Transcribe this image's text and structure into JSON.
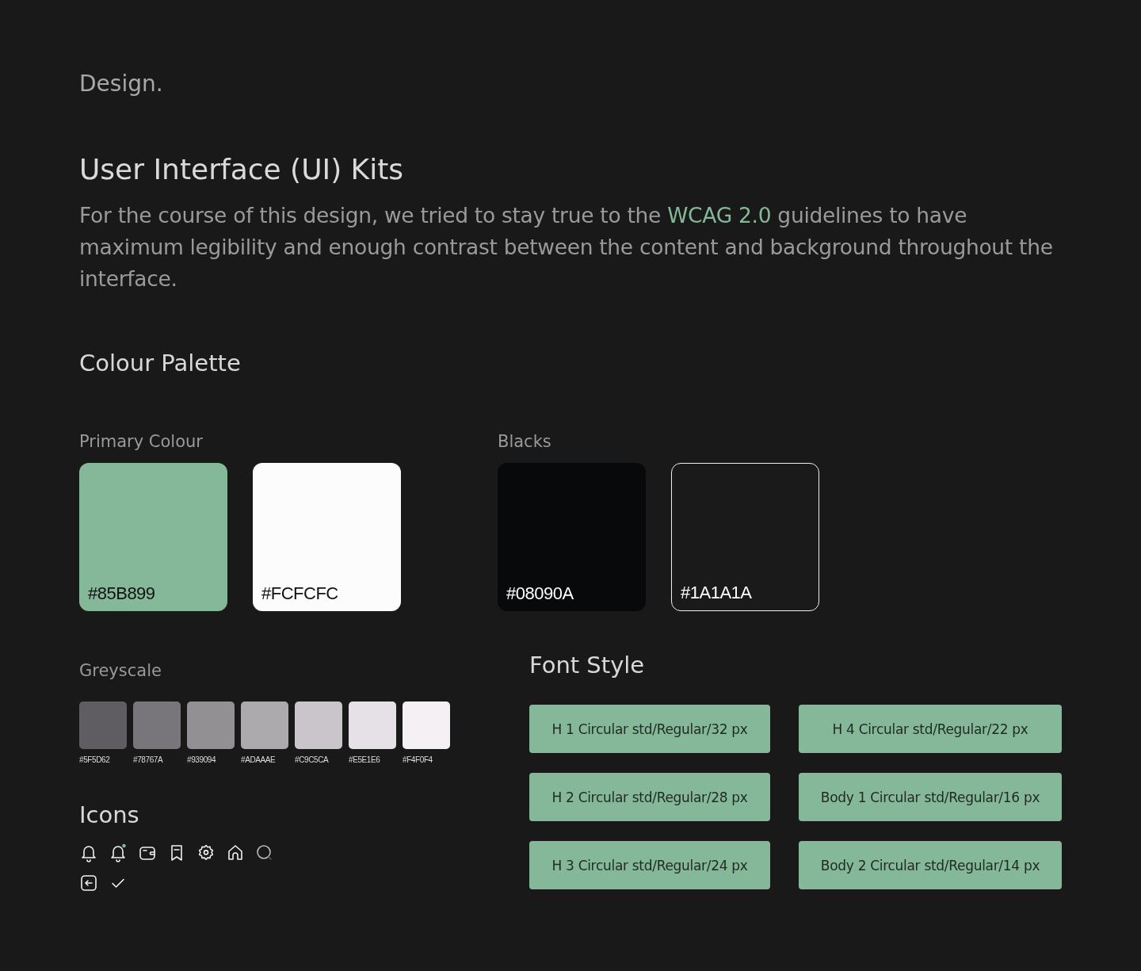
{
  "section_label": "Design.",
  "title": "User Interface (UI) Kits",
  "intro": "For the course of this design, we tried to stay true to the **WCAG 2.0** guidelines to have maximum legibility and enough contrast between the content and background throughout the interface.",
  "palette": {
    "heading": "Colour Palette",
    "groups": [
      {
        "label": "Primary Colour",
        "swatches": [
          {
            "color": "#85b899",
            "label": "#85B899",
            "outlined": false
          },
          {
            "color": "#fcfcfc",
            "label": "#FCFCFC",
            "outlined": false
          }
        ]
      },
      {
        "label": "Blacks",
        "swatches": [
          {
            "color": "#08090a",
            "label": "#08090A",
            "outlined": false
          },
          {
            "color": "#1a1a1a",
            "label": "#1A1A1A",
            "outlined": true
          }
        ]
      }
    ]
  },
  "greyscale": {
    "heading": "Greyscale",
    "swatches": [
      {
        "color": "#5f5d62",
        "label": "#5F5D62"
      },
      {
        "color": "#78767a",
        "label": "#78767A"
      },
      {
        "color": "#939094",
        "label": "#939094"
      },
      {
        "color": "#adaaae",
        "label": "#ADAAAE"
      },
      {
        "color": "#c9c5ca",
        "label": "#C9C5CA"
      },
      {
        "color": "#e5e1e6",
        "label": "#E5E1E6"
      },
      {
        "color": "#f4f0f4",
        "label": "#F4F0F4"
      }
    ]
  },
  "icons": {
    "heading": "Icons"
  },
  "font_style": {
    "heading": "Font Style",
    "styles": [
      "H 1 Circular std/Regular/32 px",
      "H 4 Circular std/Regular/22 px",
      "H 2 Circular std/Regular/28 px",
      "Body 1 Circular std/Regular/16 px",
      "H 3 Circular std/Regular/24 px",
      "Body 2 Circular std/Regular/14 px"
    ]
  }
}
